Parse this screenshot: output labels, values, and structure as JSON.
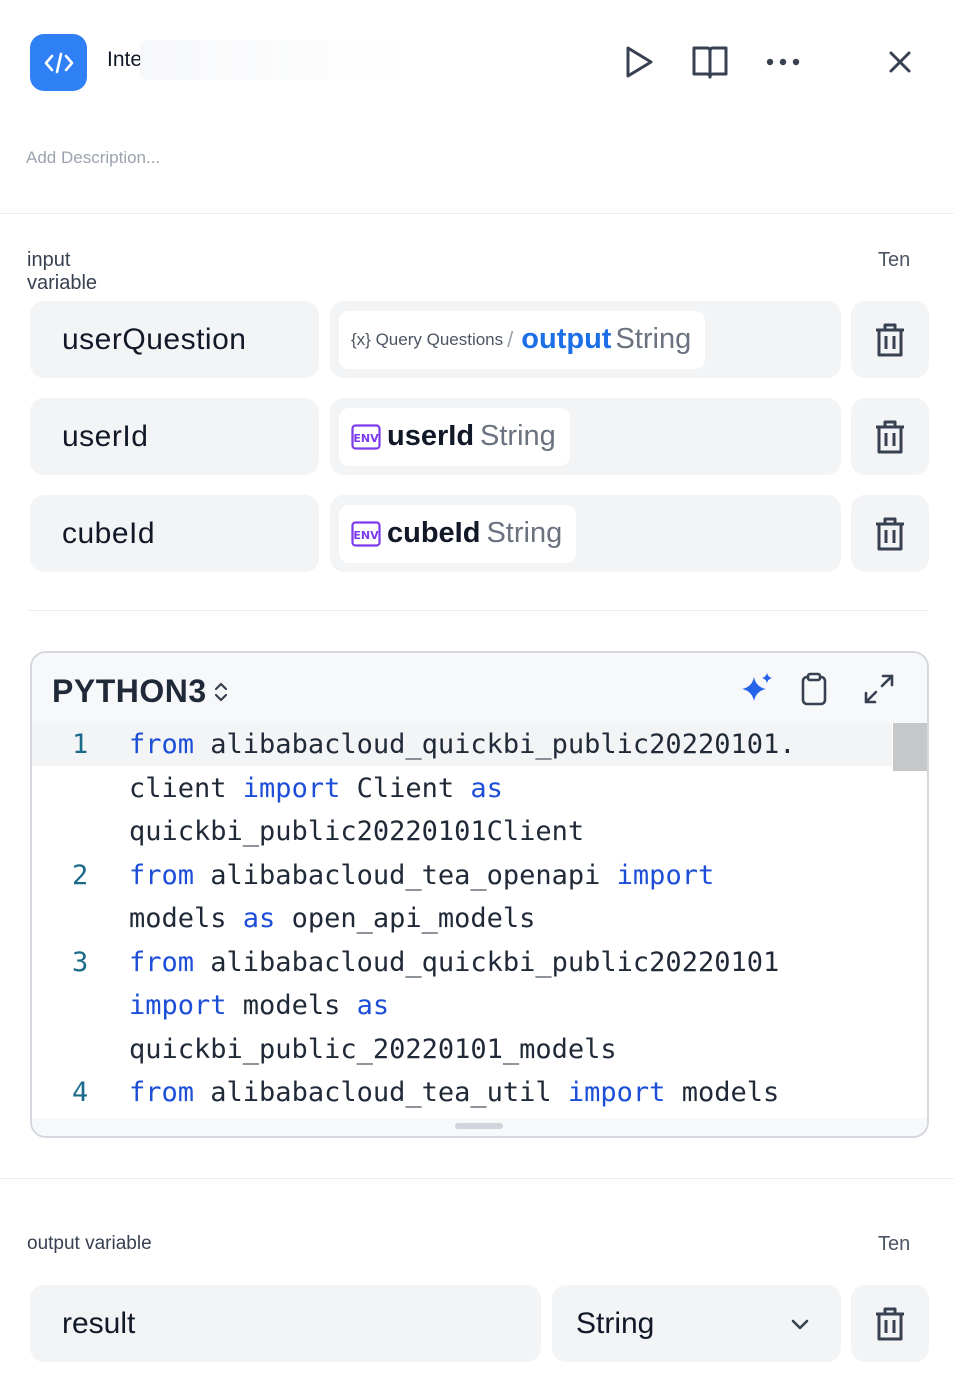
{
  "header": {
    "title": "Inte",
    "description_placeholder": "Add Description..."
  },
  "input_section": {
    "label_line1": "input",
    "label_line2": "variable",
    "right_label": "Ten",
    "rows": [
      {
        "name": "userQuestion",
        "source": "{x} Query Questions",
        "separator": "/",
        "variable": "output",
        "type": "String"
      },
      {
        "name": "userId",
        "env": "ENV",
        "variable": "userId",
        "type": "String"
      },
      {
        "name": "cubeId",
        "env": "ENV",
        "variable": "cubeId",
        "type": "String"
      }
    ]
  },
  "editor": {
    "language": "PYTHON3",
    "lines": [
      {
        "num": "1",
        "rows": [
          [
            {
              "t": "from",
              "k": true
            },
            {
              "t": " alibabacloud_quickbi_public20220101."
            }
          ],
          [
            {
              "t": "client "
            },
            {
              "t": "import",
              "k": true
            },
            {
              "t": " Client "
            },
            {
              "t": "as",
              "k": true
            }
          ],
          [
            {
              "t": "quickbi_public20220101Client"
            }
          ]
        ]
      },
      {
        "num": "2",
        "rows": [
          [
            {
              "t": "from",
              "k": true
            },
            {
              "t": " alibabacloud_tea_openapi "
            },
            {
              "t": "import",
              "k": true
            }
          ],
          [
            {
              "t": "models "
            },
            {
              "t": "as",
              "k": true
            },
            {
              "t": " open_api_models"
            }
          ]
        ]
      },
      {
        "num": "3",
        "rows": [
          [
            {
              "t": "from",
              "k": true
            },
            {
              "t": " alibabacloud_quickbi_public20220101"
            }
          ],
          [
            {
              "t": "import",
              "k": true
            },
            {
              "t": " models "
            },
            {
              "t": "as",
              "k": true
            }
          ],
          [
            {
              "t": "quickbi_public_20220101_models"
            }
          ]
        ]
      },
      {
        "num": "4",
        "rows": [
          [
            {
              "t": "from",
              "k": true
            },
            {
              "t": " alibabacloud_tea_util "
            },
            {
              "t": "import",
              "k": true
            },
            {
              "t": " models"
            }
          ]
        ]
      }
    ]
  },
  "output_section": {
    "label": "output variable",
    "right_label": "Ten",
    "name": "result",
    "type": "String"
  },
  "colors": {
    "accent": "#2f80f5",
    "keyword": "#1d4ed8",
    "env_purple": "#7c3aed",
    "sparkle": "#2563eb"
  }
}
